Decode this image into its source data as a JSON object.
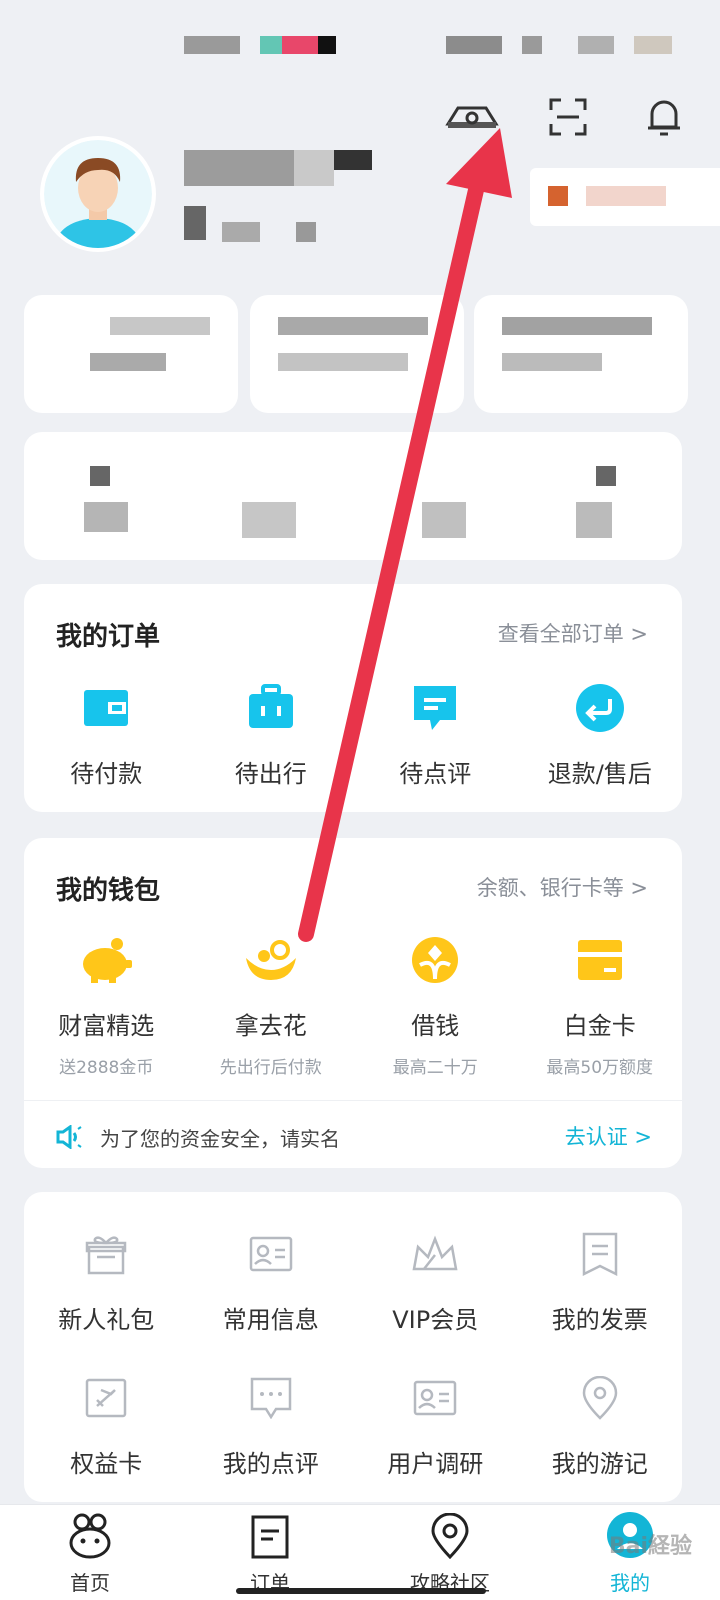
{
  "header": {
    "camera_icon": "camera-icon",
    "scan_icon": "scan-icon",
    "bell_icon": "bell-icon"
  },
  "orders": {
    "title": "我的订单",
    "view_all": "查看全部订单 >",
    "items": [
      {
        "label": "待付款",
        "icon": "wallet-icon"
      },
      {
        "label": "待出行",
        "icon": "suitcase-icon"
      },
      {
        "label": "待点评",
        "icon": "comment-icon"
      },
      {
        "label": "退款/售后",
        "icon": "refund-icon"
      }
    ]
  },
  "wallet": {
    "title": "我的钱包",
    "link": "余额、银行卡等 >",
    "items": [
      {
        "label": "财富精选",
        "sub": "送2888金币",
        "icon": "piggy-bank-icon"
      },
      {
        "label": "拿去花",
        "sub": "先出行后付款",
        "icon": "flower-icon"
      },
      {
        "label": "借钱",
        "sub": "最高二十万",
        "icon": "coin-icon"
      },
      {
        "label": "白金卡",
        "sub": "最高50万额度",
        "icon": "card-icon"
      }
    ],
    "notice": "为了您的资金安全，请实名",
    "notice_action": "去认证 >"
  },
  "services": {
    "items": [
      {
        "label": "新人礼包",
        "icon": "gift-icon"
      },
      {
        "label": "常用信息",
        "icon": "id-card-icon"
      },
      {
        "label": "VIP会员",
        "icon": "crown-icon"
      },
      {
        "label": "我的发票",
        "icon": "invoice-icon"
      },
      {
        "label": "权益卡",
        "icon": "flight-card-icon"
      },
      {
        "label": "我的点评",
        "icon": "review-icon"
      },
      {
        "label": "用户调研",
        "icon": "survey-icon"
      },
      {
        "label": "我的游记",
        "icon": "location-pin-icon"
      }
    ]
  },
  "tabbar": {
    "tabs": [
      {
        "label": "首页",
        "icon": "home-icon"
      },
      {
        "label": "订单",
        "icon": "order-icon"
      },
      {
        "label": "攻略社区",
        "icon": "map-pin-icon"
      },
      {
        "label": "我的",
        "icon": "profile-icon"
      }
    ]
  },
  "colors": {
    "accent": "#13b5d6",
    "wallet_yellow": "#ffc619",
    "arrow": "#e8344a"
  },
  "watermark": "Bai経验"
}
